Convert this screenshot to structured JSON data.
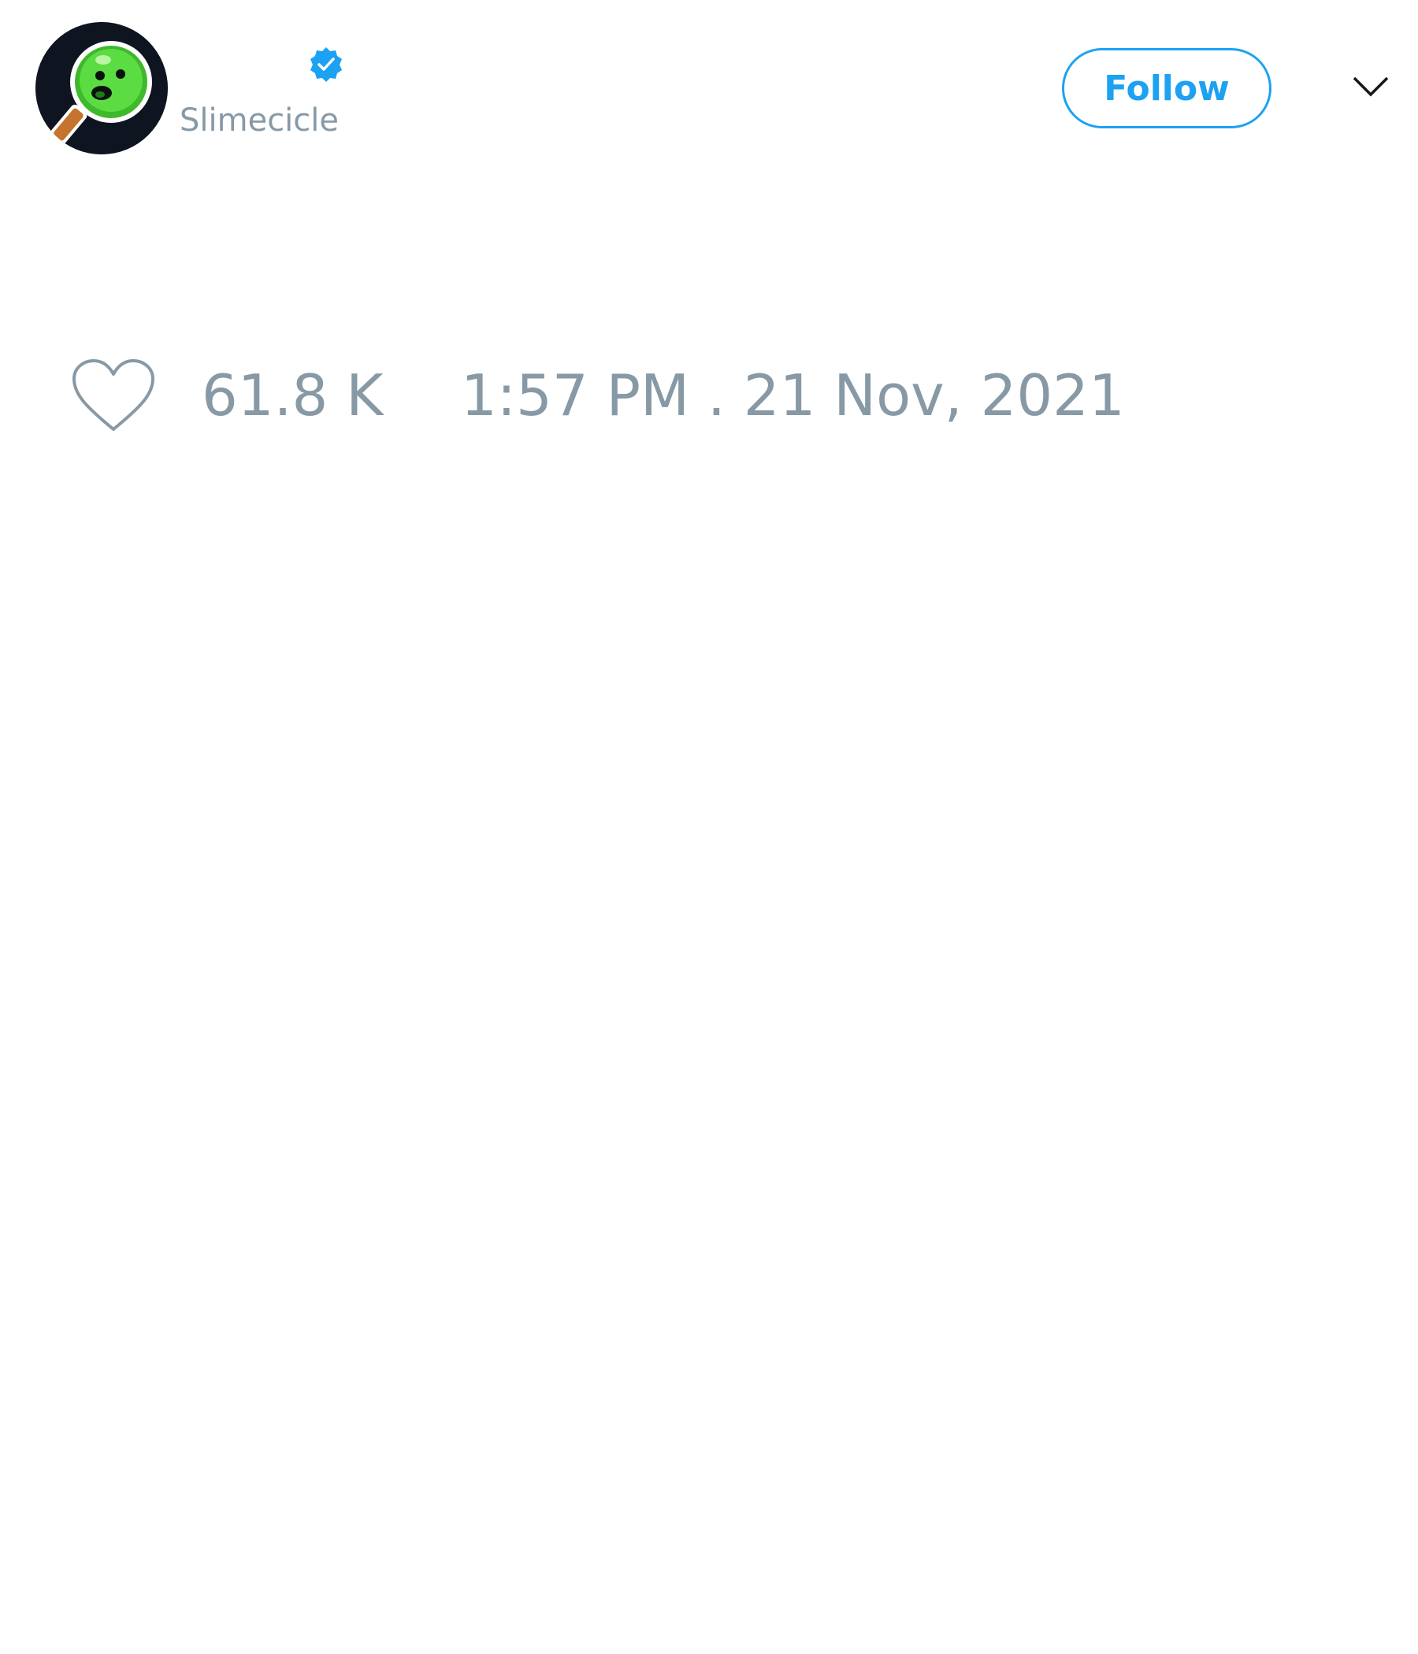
{
  "tweet": {
    "author": {
      "display_name": "",
      "username": "Slimecicle",
      "verified": true,
      "avatar_icon": "slime-popsicle-avatar"
    },
    "follow_label": "Follow",
    "menu_icon": "chevron-down-icon",
    "likes": {
      "icon": "heart-outline-icon",
      "count": "61.8 K"
    },
    "timestamp": "1:57 PM . 21 Nov, 2021"
  },
  "colors": {
    "accent": "#1da1f2",
    "muted_text": "#8899a6",
    "avatar_bg": "#0e1520",
    "slime_green": "#4fd13a",
    "stick_brown": "#c4742c"
  }
}
